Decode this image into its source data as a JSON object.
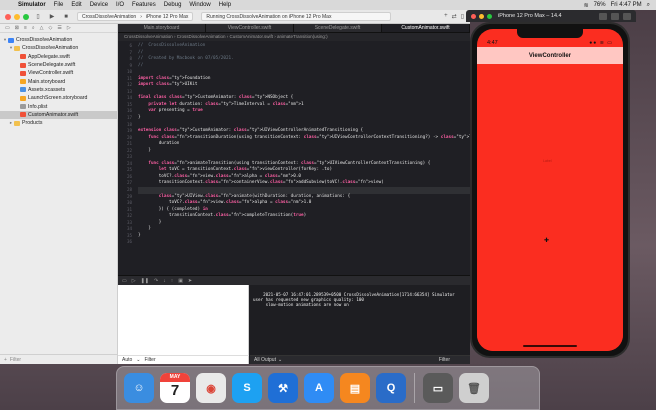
{
  "menubar": {
    "app_name": "Simulator",
    "items": [
      "File",
      "Edit",
      "Device",
      "I/O",
      "Features",
      "Debug",
      "Window",
      "Help"
    ],
    "battery": "76%",
    "clock": "Fri 4:47 PM"
  },
  "xcode": {
    "scheme": "CrossDissolveAnimation",
    "device": "iPhone 12 Pro Max",
    "status": "Running CrossDissolveAnimation on iPhone 12 Pro Max",
    "tabs": [
      "Main.storyboard",
      "ViewController.swift",
      "SceneDelegate.swift",
      "CustomAnimator.swift"
    ],
    "active_tab": 3,
    "jumpbar": "CrossDissolveAnimation  ›  CrossDissolveAnimation  ›  CustomAnimator.swift  ›  animateTransition(using:)",
    "navigator": {
      "items": [
        {
          "label": "CrossDissolveAnimation",
          "level": 0,
          "disclosure": "▾",
          "icon": "project-icon",
          "color": "#3b83f6"
        },
        {
          "label": "CrossDissolveAnimation",
          "level": 1,
          "disclosure": "▾",
          "icon": "folder-icon",
          "color": "#f2c14e"
        },
        {
          "label": "AppDelegate.swift",
          "level": 2,
          "disclosure": "",
          "icon": "swift-file-icon",
          "color": "#f05138"
        },
        {
          "label": "SceneDelegate.swift",
          "level": 2,
          "disclosure": "",
          "icon": "swift-file-icon",
          "color": "#f05138"
        },
        {
          "label": "ViewController.swift",
          "level": 2,
          "disclosure": "",
          "icon": "swift-file-icon",
          "color": "#f05138"
        },
        {
          "label": "Main.storyboard",
          "level": 2,
          "disclosure": "",
          "icon": "storyboard-icon",
          "color": "#f5a623"
        },
        {
          "label": "Assets.xcassets",
          "level": 2,
          "disclosure": "",
          "icon": "assets-icon",
          "color": "#4a90e2"
        },
        {
          "label": "LaunchScreen.storyboard",
          "level": 2,
          "disclosure": "",
          "icon": "storyboard-icon",
          "color": "#f5a623"
        },
        {
          "label": "Info.plist",
          "level": 2,
          "disclosure": "",
          "icon": "plist-icon",
          "color": "#9b9b9b"
        },
        {
          "label": "CustomAnimator.swift",
          "level": 2,
          "disclosure": "",
          "icon": "swift-file-icon",
          "color": "#f05138",
          "selected": true
        },
        {
          "label": "Products",
          "level": 1,
          "disclosure": "▸",
          "icon": "folder-icon",
          "color": "#f2c14e"
        }
      ],
      "filter_placeholder": "Filter"
    },
    "code_lines": [
      "//  CrossDissolveAnimation",
      "//",
      "//  Created by Macbook on 07/05/2021.",
      "//",
      "",
      "import Foundation",
      "import UIKit",
      "",
      "final class CustomAnimator: NSObject {",
      "    private let duration: TimeInterval = 1",
      "    var presenting = true",
      "}",
      "",
      "extension CustomAnimator: UIViewControllerAnimatedTransitioning {",
      "    func transitionDuration(using transitionContext: UIViewControllerContextTransitioning?) -> TimeInterval {",
      "        duration",
      "    }",
      "",
      "    func animateTransition(using transitionContext: UIViewControllerContextTransitioning) {",
      "        let toVC = transitionContext.viewController(forKey: .to)",
      "        toVC?.view.alpha = 0.0",
      "        transitionContext.containerView.addSubview(toVC!.view)",
      "",
      "        UIView.animate(withDuration: duration, animations: {",
      "            toVC?.view.alpha = 1.0",
      "        }) { (completed) in",
      "            transitionContext.completeTransition(true)",
      "        }",
      "    }",
      "}",
      ""
    ],
    "line_numbers": [
      "6",
      "7",
      "8",
      "9",
      "10",
      "11",
      "12",
      "13",
      "14",
      "15",
      "16",
      "17",
      "18",
      "19",
      "20",
      "21",
      "22",
      "23",
      "24",
      "25",
      "26",
      "27",
      "28",
      "29",
      "30",
      "31",
      "32",
      "33",
      "34",
      "35",
      "36"
    ],
    "highlighted_line": 22,
    "console_text": "2021-05-07 16:47:01.289539+0500 CrossDissolveAnimation[1714:66354] Simulator user has requested new graphics quality: 100\n     slow-motion animations are now on",
    "variables_scope": "Auto",
    "variables_filter": "Filter",
    "console_output": "All Output",
    "console_filter": "Filter"
  },
  "simulator": {
    "window_title": "iPhone 12 Pro Max – 14.4",
    "time": "4:47",
    "signal": "●● ≋ ▭",
    "nav_title": "ViewController",
    "faint_label": "Label",
    "screen_color": "#fb2d20",
    "navbar_color": "#ffc7c2"
  },
  "dock": {
    "apps": [
      {
        "name": "finder-icon",
        "bg": "#3a8de0",
        "glyph": "☺"
      },
      {
        "name": "calendar-icon",
        "bg": "#ffffff",
        "month": "MAY",
        "day": "7"
      },
      {
        "name": "chrome-icon",
        "bg": "#e9e9e9",
        "glyph": "◉"
      },
      {
        "name": "skype-icon",
        "bg": "#1da1f2",
        "glyph": "S"
      },
      {
        "name": "xcode-icon",
        "bg": "#1f6fd6",
        "glyph": "⚒"
      },
      {
        "name": "app-store-icon",
        "bg": "#2f8cf5",
        "glyph": "A"
      },
      {
        "name": "books-icon",
        "bg": "#f5871f",
        "glyph": "▤"
      },
      {
        "name": "quicktime-icon",
        "bg": "#2a6cc8",
        "glyph": "Q"
      },
      {
        "name": "simulator-icon",
        "bg": "#5a5a5a",
        "glyph": "▭"
      },
      {
        "name": "trash-icon",
        "bg": "#cfcfcf",
        "glyph": "🗑"
      }
    ]
  }
}
